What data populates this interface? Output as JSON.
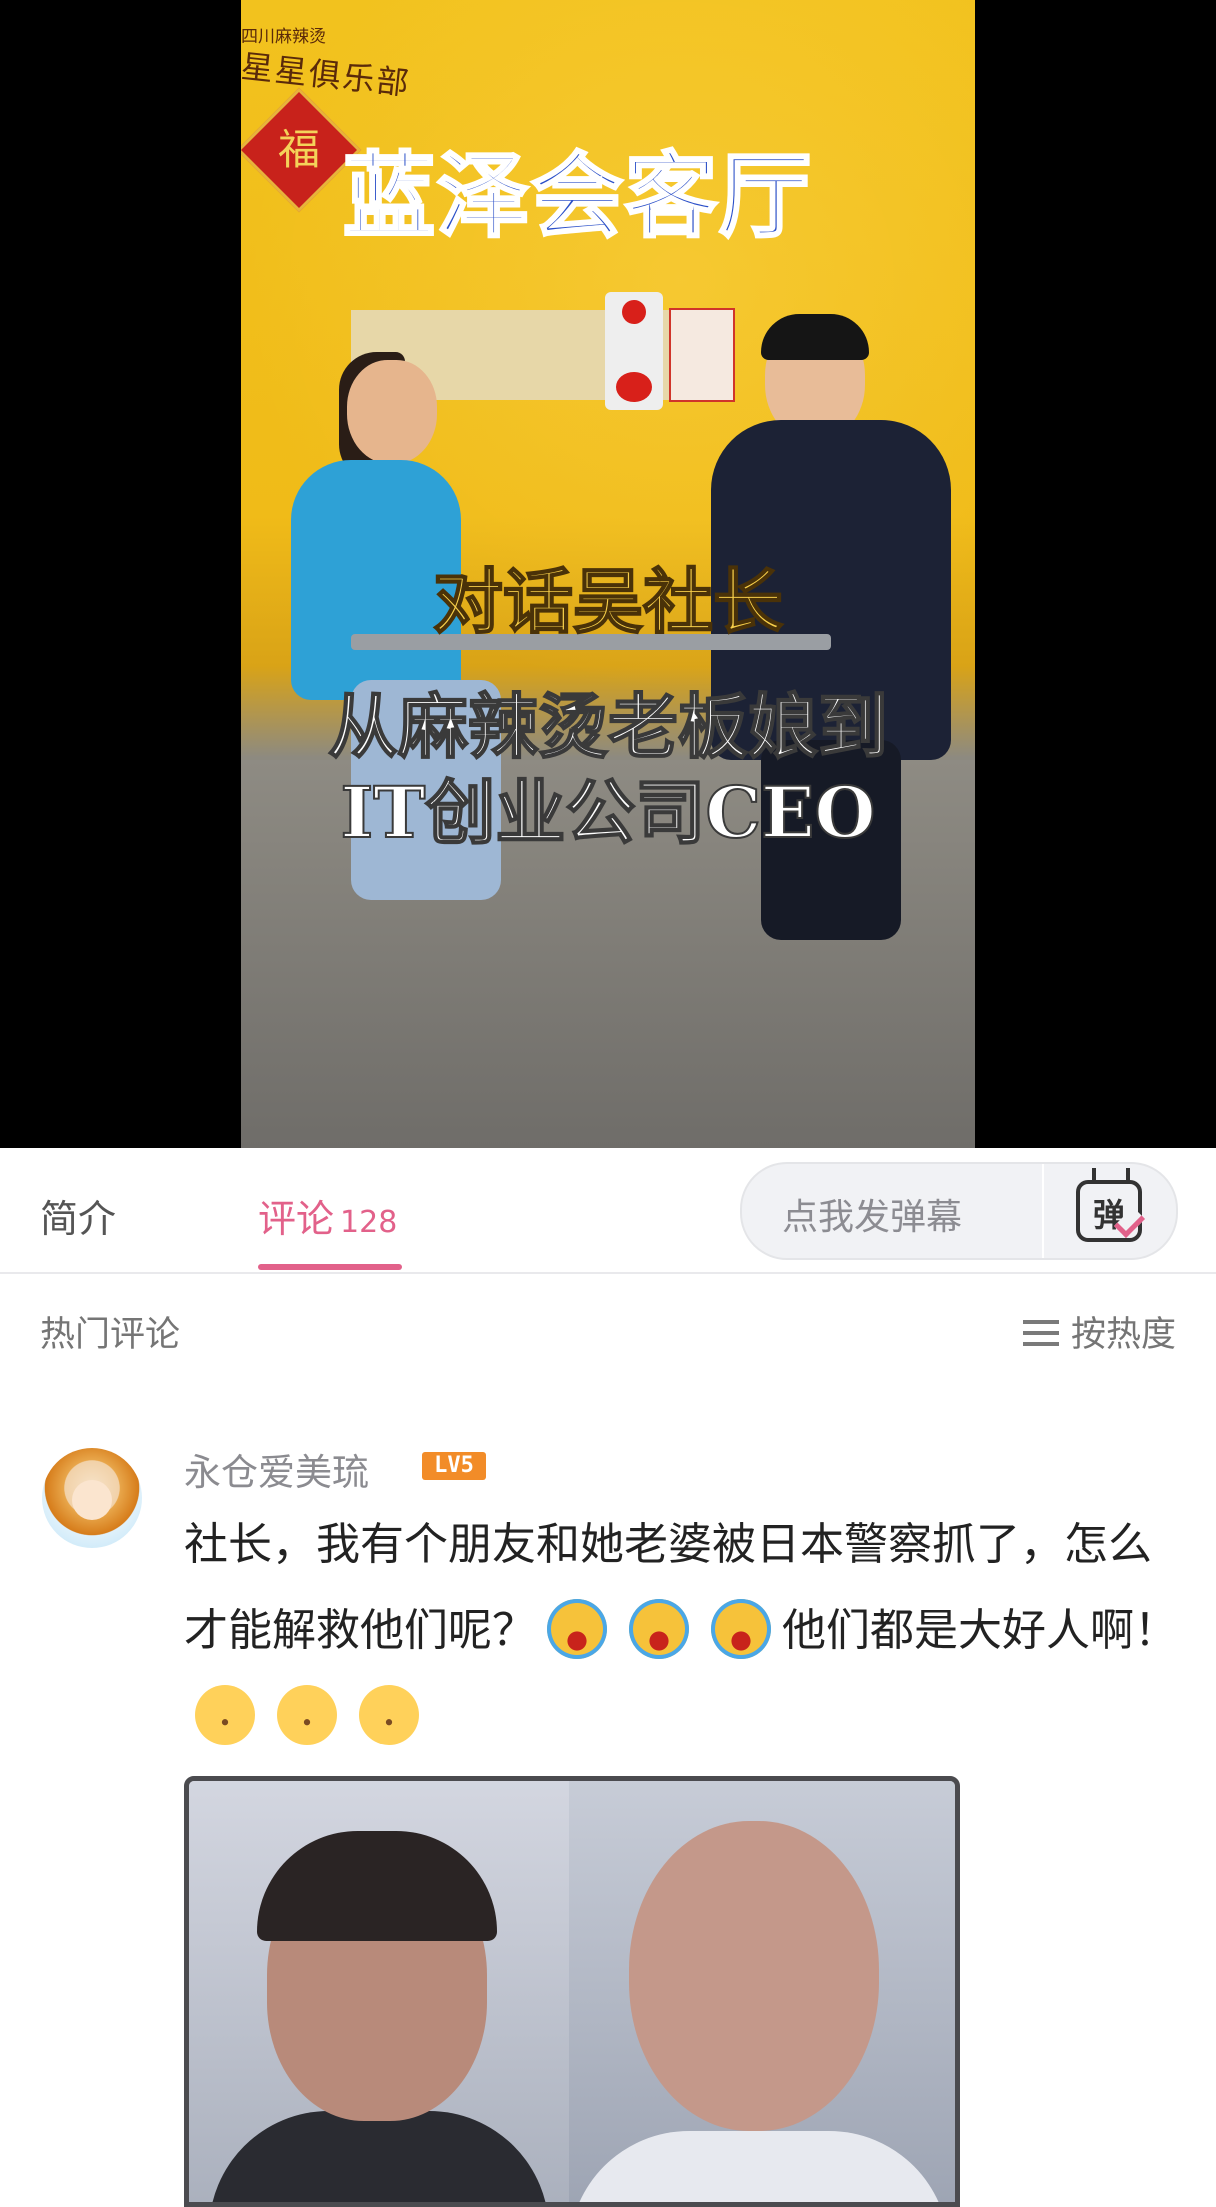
{
  "video": {
    "sign_small": "四川麻辣烫",
    "sign_club": "星星俱乐部",
    "fu_char": "福",
    "show_title": "蓝泽会客厅",
    "caption_line1": "对话吴社长",
    "caption_line2": "从麻辣烫老板娘到",
    "caption_line3": "IT创业公司CEO"
  },
  "tabs": {
    "intro_label": "简介",
    "comments_label": "评论",
    "comments_count": "128"
  },
  "danmaku": {
    "placeholder": "点我发弹幕",
    "icon_char": "弹",
    "icon": "danmaku-toggle-icon"
  },
  "comments_header": {
    "title": "热门评论",
    "sort_label": "按热度",
    "sort_icon": "menu-lines-icon"
  },
  "comment": {
    "username": "永仓爱美琉",
    "level": "LV5",
    "text_part1": "社长，我有个朋友和她老婆被日本警察抓了，怎么才能解救他们呢？",
    "text_part2": "他们都是大好人啊！",
    "emojis_after_part1": [
      "loud-crying-emoji",
      "loud-crying-emoji",
      "loud-crying-emoji"
    ],
    "emojis_after_part2": [
      "laugh-cry-emoji",
      "laugh-cry-emoji",
      "laugh-cry-emoji"
    ]
  },
  "colors": {
    "accent_pink": "#e2618a",
    "level_badge": "#f28c28",
    "video_wall": "#f0bb18",
    "title_blue": "#2a4fc8"
  }
}
